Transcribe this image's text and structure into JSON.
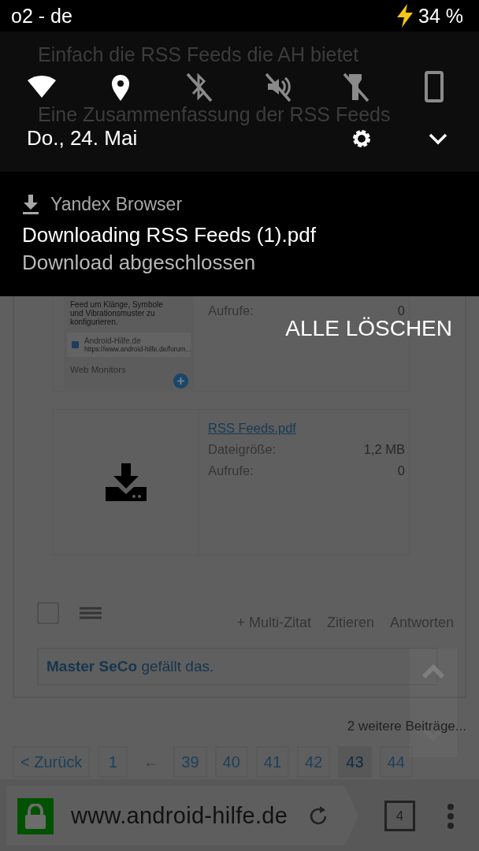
{
  "status_bar": {
    "carrier": "o2 - de",
    "charging": true,
    "battery": "34 %"
  },
  "quick_settings": {
    "toggles": [
      {
        "kind": "wifi",
        "on": true
      },
      {
        "kind": "location",
        "on": true
      },
      {
        "kind": "bluetooth",
        "on": false
      },
      {
        "kind": "sound",
        "on": false
      },
      {
        "kind": "flashlight",
        "on": false
      },
      {
        "kind": "rotation",
        "on": false
      }
    ],
    "date": "Do., 24. Mai"
  },
  "notification": {
    "app": "Yandex Browser",
    "title": "Downloading RSS Feeds (1).pdf",
    "text": "Download abgeschlossen"
  },
  "clear_all": "ALLE LÖSCHEN",
  "page": {
    "background_text": [
      "Einfach die RSS Feeds die AH bietet",
      "Eine Zusammenfassung der RSS Feeds"
    ],
    "attachments": [
      {
        "kind": "screenshot",
        "screenshot": {
          "lines": [
            "Feed um Klänge, Symbole",
            "und Vibrationsmuster zu",
            "konfigurieren."
          ],
          "feed": {
            "title": "Android-Hilfe.de",
            "url": "https://www.android-hilfe.de/forum...",
            "checked": true
          },
          "section": "Web Monitors"
        },
        "fields": [
          {
            "label": "Aufrufe:",
            "value": "0"
          }
        ]
      },
      {
        "kind": "file",
        "link": "RSS Feeds.pdf",
        "fields": [
          {
            "label": "Dateigröße:",
            "value": "1,2 MB"
          },
          {
            "label": "Aufrufe:",
            "value": "0"
          }
        ]
      }
    ],
    "post_checked": false,
    "actions": [
      "+ Multi-Zitat",
      "Zitieren",
      "Antworten"
    ],
    "likes": "**Master SeCo** gefällt das.",
    "more_posts": "2 weitere Beiträge...",
    "pagination": [
      {
        "kind": "page",
        "label": "< Zurück",
        "selected": false
      },
      {
        "kind": "page",
        "label": "1",
        "selected": false
      },
      {
        "kind": "gap",
        "label": "←"
      },
      {
        "kind": "page",
        "label": "39",
        "selected": false
      },
      {
        "kind": "page",
        "label": "40",
        "selected": false
      },
      {
        "kind": "page",
        "label": "41",
        "selected": false
      },
      {
        "kind": "page",
        "label": "42",
        "selected": false
      },
      {
        "kind": "page",
        "label": "43",
        "selected": true
      },
      {
        "kind": "page",
        "label": "44",
        "selected": false
      }
    ]
  },
  "browser_bar": {
    "url": "www.android-hilfe.de",
    "tab_count": "4"
  }
}
